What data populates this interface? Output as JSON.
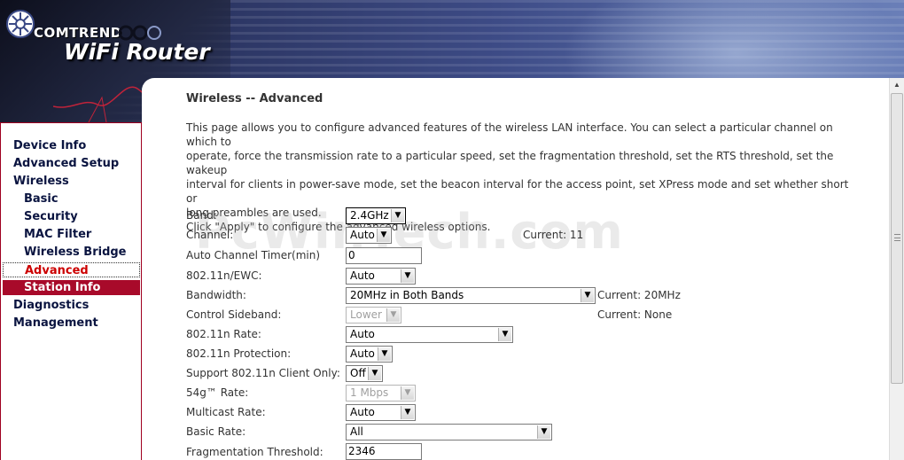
{
  "header": {
    "brand": "COMTREND",
    "product": "WiFi Router"
  },
  "sidebar": {
    "items": [
      {
        "label": "Device Info"
      },
      {
        "label": "Advanced Setup"
      },
      {
        "label": "Wireless"
      },
      {
        "label": "Basic"
      },
      {
        "label": "Security"
      },
      {
        "label": "MAC Filter"
      },
      {
        "label": "Wireless Bridge"
      },
      {
        "label": "Advanced"
      },
      {
        "label": "Station Info"
      },
      {
        "label": "Diagnostics"
      },
      {
        "label": "Management"
      }
    ]
  },
  "main": {
    "title": "Wireless -- Advanced",
    "intro_lines": [
      "This page allows you to configure advanced features of the wireless LAN interface. You can select a particular channel on which to",
      "operate, force the transmission rate to a particular speed, set the fragmentation threshold, set the RTS threshold, set the wakeup",
      "interval for clients in power-save mode, set the beacon interval for the access point, set XPress mode and set whether short or",
      "long preambles are used.",
      "Click \"Apply\" to configure the advanced wireless options."
    ],
    "watermark": "PcWinTech.com",
    "fields": {
      "band": {
        "label": "Band:",
        "value": "2.4GHz"
      },
      "channel": {
        "label": "Channel:",
        "value": "Auto",
        "current": "Current: 11"
      },
      "auto_channel_timer": {
        "label": "Auto Channel Timer(min)",
        "value": "0"
      },
      "ewc": {
        "label": "802.11n/EWC:",
        "value": "Auto"
      },
      "bandwidth": {
        "label": "Bandwidth:",
        "value": "20MHz in Both Bands",
        "current": "Current: 20MHz"
      },
      "control_sideband": {
        "label": "Control Sideband:",
        "value": "Lower",
        "current": "Current: None"
      },
      "n_rate": {
        "label": "802.11n Rate:",
        "value": "Auto"
      },
      "n_protection": {
        "label": "802.11n Protection:",
        "value": "Auto"
      },
      "n_client_only": {
        "label": "Support 802.11n Client Only:",
        "value": "Off"
      },
      "g_rate": {
        "label": "54g™ Rate:",
        "value": "1 Mbps"
      },
      "multicast_rate": {
        "label": "Multicast Rate:",
        "value": "Auto"
      },
      "basic_rate": {
        "label": "Basic Rate:",
        "value": "All"
      },
      "frag_threshold": {
        "label": "Fragmentation Threshold:",
        "value": "2346"
      }
    }
  },
  "colors": {
    "nav_highlight": "#a80a2a",
    "nav_current_text": "#cc0000",
    "nav_text": "#0a1440",
    "sidebar_border": "#9f0020"
  }
}
